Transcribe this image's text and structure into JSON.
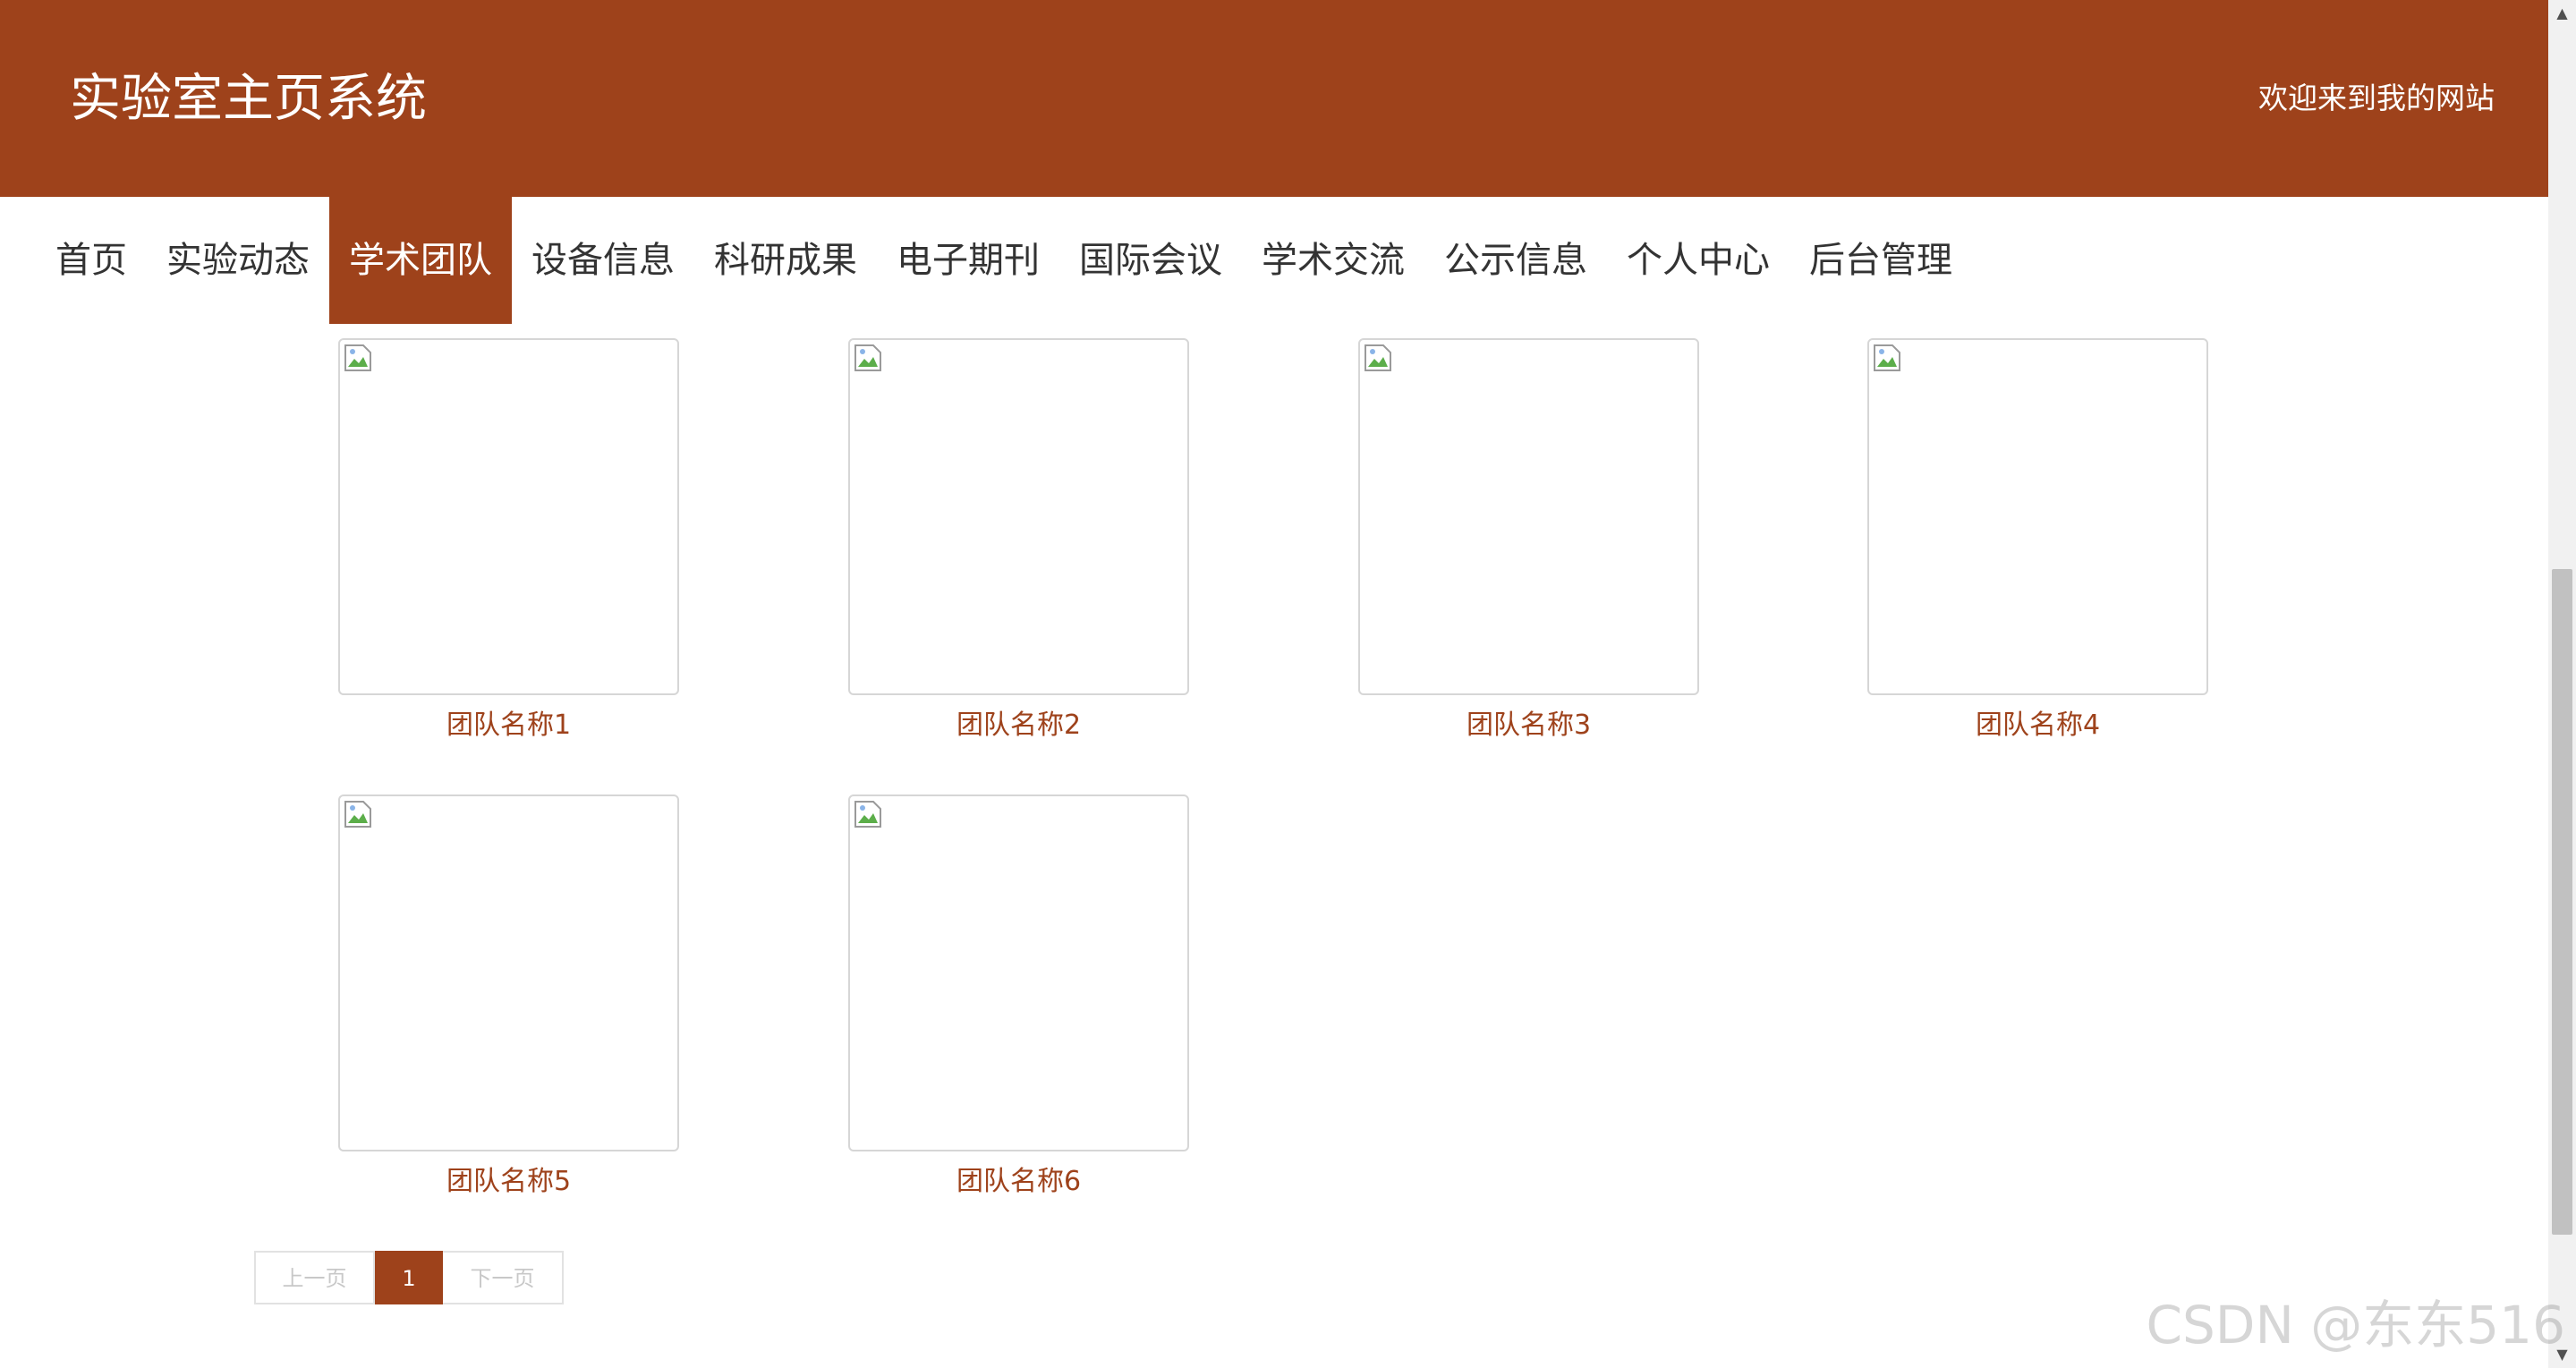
{
  "header": {
    "site_title": "实验室主页系统",
    "welcome": "欢迎来到我的网站"
  },
  "nav": {
    "items": [
      {
        "label": "首页"
      },
      {
        "label": "实验动态"
      },
      {
        "label": "学术团队",
        "active": true
      },
      {
        "label": "设备信息"
      },
      {
        "label": "科研成果"
      },
      {
        "label": "电子期刊"
      },
      {
        "label": "国际会议"
      },
      {
        "label": "学术交流"
      },
      {
        "label": "公示信息"
      },
      {
        "label": "个人中心"
      },
      {
        "label": "后台管理"
      }
    ]
  },
  "teams": [
    {
      "name": "团队名称1"
    },
    {
      "name": "团队名称2"
    },
    {
      "name": "团队名称3"
    },
    {
      "name": "团队名称4"
    },
    {
      "name": "团队名称5"
    },
    {
      "name": "团队名称6"
    }
  ],
  "pagination": {
    "prev": "上一页",
    "current": "1",
    "next": "下一页"
  },
  "watermark": "CSDN @东东516",
  "colors": {
    "brand": "#9e421b",
    "header_text": "#ffffff",
    "nav_text": "#333333",
    "team_name": "#9e421b"
  },
  "icons": {
    "card_image": "broken-image-icon",
    "scroll_up": "triangle-up-icon",
    "scroll_down": "triangle-down-icon"
  }
}
